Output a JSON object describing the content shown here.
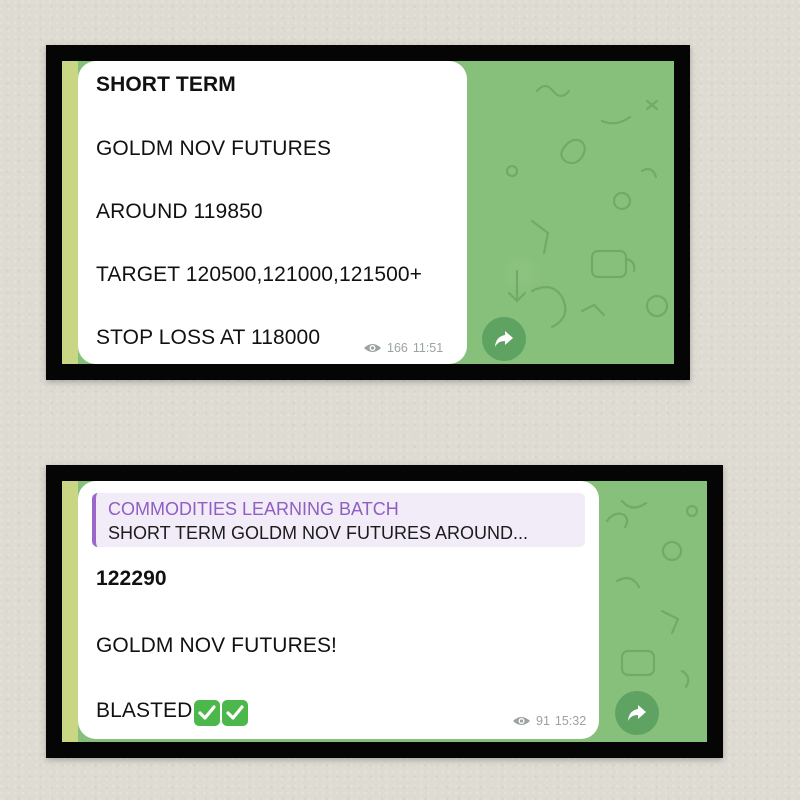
{
  "message1": {
    "lines": [
      "SHORT TERM",
      "GOLDM NOV FUTURES",
      "AROUND 119850",
      "TARGET 120500,121000,121500+",
      "STOP LOSS AT 118000"
    ],
    "views": "166",
    "time": "11:51"
  },
  "message2": {
    "reply_title": "COMMODITIES LEARNING BATCH",
    "reply_text": "SHORT TERM GOLDM NOV FUTURES AROUND...",
    "lines": [
      "122290",
      "GOLDM NOV FUTURES!",
      "BLASTED"
    ],
    "views": "91",
    "time": "15:32"
  },
  "colors": {
    "chat_background": "#87c07a",
    "share_button": "#5fa363",
    "reply_accent": "#9b67c9",
    "checkmark": "#4cb84b"
  },
  "icons": [
    "eye-icon",
    "share-arrow-icon",
    "check-mark-emoji"
  ]
}
